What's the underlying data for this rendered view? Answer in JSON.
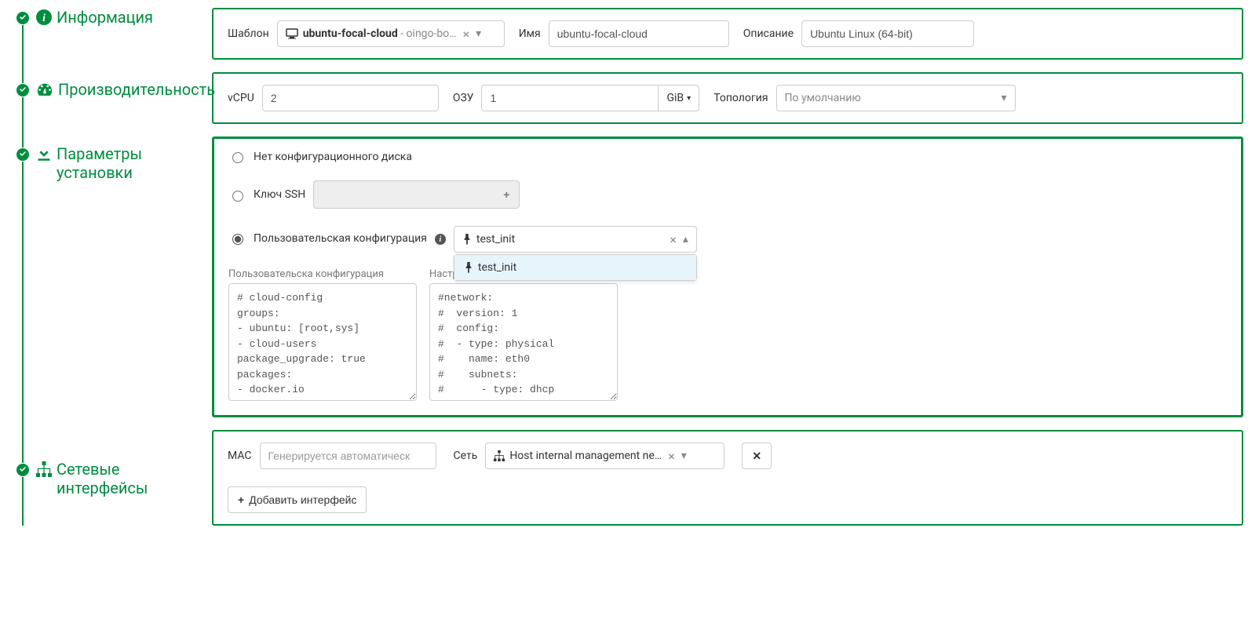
{
  "steps": {
    "info": "Информация",
    "perf": "Производительность",
    "install": "Параметры установки",
    "net": "Сетевые интерфейсы"
  },
  "info": {
    "template_label": "Шаблон",
    "template_value": "ubuntu-focal-cloud",
    "template_suffix": "- oingo-bo…",
    "name_label": "Имя",
    "name_value": "ubuntu-focal-cloud",
    "desc_label": "Описание",
    "desc_value": "Ubuntu Linux (64-bit)"
  },
  "perf": {
    "vcpu_label": "vCPU",
    "vcpu_value": "2",
    "ram_label": "ОЗУ",
    "ram_value": "1",
    "ram_unit": "GiB",
    "topo_label": "Топология",
    "topo_placeholder": "По умолчанию"
  },
  "install": {
    "no_config": "Нет конфигурационного диска",
    "ssh_key": "Ключ SSH",
    "custom_config": "Пользовательская конфигурация",
    "config_selected": "test_init",
    "config_option": "test_init",
    "user_config_label": "Пользовательска конфигурация",
    "net_config_label": "Настройка сети",
    "user_config_text": "# cloud-config\ngroups:\n- ubuntu: [root,sys]\n- cloud-users\npackage_upgrade: true\npackages:\n- docker.io",
    "net_config_text": "#network:\n#  version: 1\n#  config:\n#  - type: physical\n#    name: eth0\n#    subnets:\n#      - type: dhcp"
  },
  "net": {
    "mac_label": "MAC",
    "mac_placeholder": "Генерируется автоматическ",
    "net_label": "Сеть",
    "net_value": "Host internal management ne…",
    "add_iface": "Добавить интерфейс"
  }
}
